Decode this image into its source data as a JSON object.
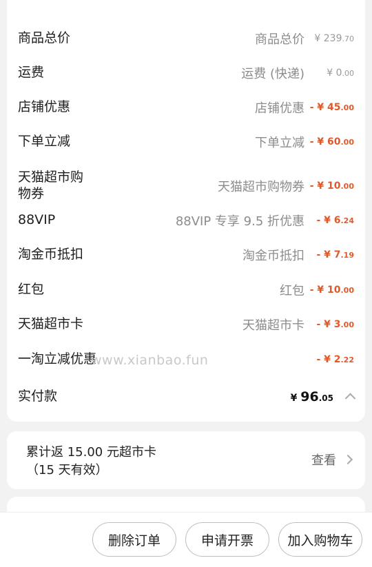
{
  "summary": {
    "rows": [
      {
        "label": "商品总价",
        "desc": "商品总价",
        "currency": "¥",
        "int": "239",
        "dec": ".70",
        "negative": false
      },
      {
        "label": "运费",
        "desc": "运费 (快递)",
        "currency": "¥",
        "int": "0",
        "dec": ".00",
        "negative": false
      },
      {
        "label": "店铺优惠",
        "desc": "店铺优惠",
        "currency": "- ¥",
        "int": "45",
        "dec": ".00",
        "negative": true
      },
      {
        "label": "下单立减",
        "desc": "下单立减",
        "currency": "- ¥",
        "int": "60",
        "dec": ".00",
        "negative": true
      },
      {
        "label": "天猫超市购物券",
        "desc": "天猫超市购物券",
        "currency": "- ¥",
        "int": "10",
        "dec": ".00",
        "negative": true
      },
      {
        "label": "88VIP",
        "desc": "88VIP 专享 9.5 折优惠",
        "currency": "- ¥",
        "int": "6",
        "dec": ".24",
        "negative": true
      },
      {
        "label": "淘金币抵扣",
        "desc": "淘金币抵扣",
        "currency": "- ¥",
        "int": "7",
        "dec": ".19",
        "negative": true
      },
      {
        "label": "红包",
        "desc": "红包",
        "currency": "- ¥",
        "int": "10",
        "dec": ".00",
        "negative": true
      },
      {
        "label": "天猫超市卡",
        "desc": "天猫超市卡",
        "currency": "- ¥",
        "int": "3",
        "dec": ".00",
        "negative": true
      },
      {
        "label": "一淘立减优惠",
        "desc": "",
        "currency": "- ¥",
        "int": "2",
        "dec": ".22",
        "negative": true
      }
    ],
    "watermark": "www.xianbao.fun",
    "total": {
      "label": "实付款",
      "currency": "¥",
      "int": "96",
      "dec": ".05"
    }
  },
  "rebate": {
    "line1": "累计返 15.00 元超市卡",
    "line2": "（15 天有效）",
    "link": "查看"
  },
  "actions": {
    "delete_order": "删除订单",
    "request_invoice": "申请开票",
    "add_to_cart": "加入购物车"
  }
}
